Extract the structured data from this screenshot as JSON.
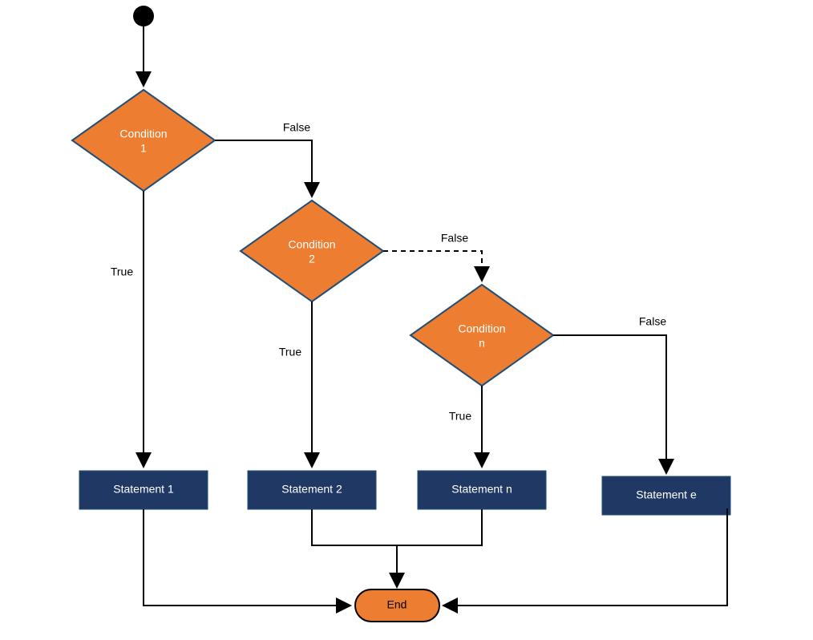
{
  "nodes": {
    "condition1": {
      "line1": "Condition",
      "line2": "1"
    },
    "condition2": {
      "line1": "Condition",
      "line2": "2"
    },
    "conditionN": {
      "line1": "Condition",
      "line2": "n"
    },
    "statement1": "Statement 1",
    "statement2": "Statement 2",
    "statementN": "Statement n",
    "statementE": "Statement e",
    "end": "End"
  },
  "labels": {
    "true": "True",
    "false": "False"
  },
  "colors": {
    "diamond_fill": "#ED7D31",
    "box_fill": "#1F3864",
    "outline": "#1F4E79"
  }
}
